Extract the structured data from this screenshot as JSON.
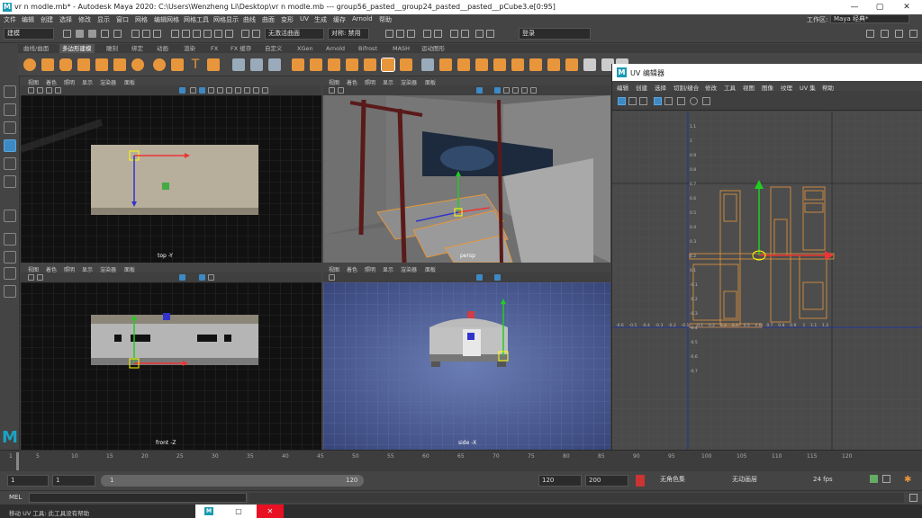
{
  "window": {
    "title": "vr n modle.mb* - Autodesk Maya 2020: C:\\Users\\Wenzheng Li\\Desktop\\vr n modle.mb   ---   group56_pasted__group24_pasted__pasted__pCube3.e[0:95]",
    "app_icon_letter": "M",
    "minimize": "—",
    "maximize": "▢",
    "close": "✕"
  },
  "menubar": {
    "items": [
      "文件",
      "编辑",
      "创建",
      "选择",
      "修改",
      "显示",
      "窗口",
      "网格",
      "编辑网格",
      "网格工具",
      "网格显示",
      "曲线",
      "曲面",
      "变形",
      "UV",
      "生成",
      "缓存",
      "Arnold",
      "帮助"
    ],
    "workspace_label": "工作区:",
    "workspace_value": "Maya 经典*"
  },
  "statusline": {
    "menuset": "建模",
    "object_field": "无激活曲面",
    "symmetry": "对称: 禁用",
    "login": "登录"
  },
  "shelf": {
    "tabs": [
      "曲线/曲面",
      "多边形建模",
      "雕刻",
      "绑定",
      "动画",
      "渲染",
      "FX",
      "FX 缓存",
      "自定义",
      "XGen",
      "Arnold",
      "Bifrost",
      "MASH",
      "运动图形"
    ],
    "active_tab_index": 1
  },
  "viewports": {
    "menu": [
      "视图",
      "着色",
      "照明",
      "显示",
      "渲染器",
      "面板"
    ],
    "top": {
      "camera": "top -Y"
    },
    "persp": {
      "camera": "persp"
    },
    "front": {
      "camera": "front -Z"
    },
    "side": {
      "camera": "side -X"
    }
  },
  "uv_editor": {
    "title": "UV 编辑器",
    "menu": [
      "编辑",
      "创建",
      "选择",
      "切割/缝合",
      "修改",
      "工具",
      "视图",
      "图像",
      "纹理",
      "UV 集",
      "帮助"
    ],
    "axis_labels_x": [
      "-0.6",
      "-0.5",
      "-0.4",
      "-0.3",
      "-0.2",
      "-0.1",
      "0.1",
      "0.2",
      "0.3",
      "0.4",
      "0.5",
      "0.6",
      "0.7",
      "0.8",
      "0.9",
      "1",
      "1.1",
      "1.2"
    ],
    "axis_labels_y": [
      "1.1",
      "1",
      "0.9",
      "0.8",
      "0.7",
      "0.6",
      "0.5",
      "0.4",
      "0.3",
      "0.2",
      "0.1",
      "-0.1",
      "-0.2",
      "-0.3",
      "-0.4",
      "-0.5",
      "-0.6",
      "-0.7"
    ]
  },
  "timeline": {
    "ticks": [
      "1",
      "5",
      "10",
      "15",
      "20",
      "25",
      "30",
      "35",
      "40",
      "45",
      "50",
      "55",
      "60",
      "65",
      "70",
      "75",
      "80",
      "85",
      "90",
      "95",
      "100",
      "105",
      "110",
      "115",
      "120"
    ],
    "current_frame": "1"
  },
  "range": {
    "start": "1",
    "playback_start": "1",
    "range_start_label": "1",
    "range_end_label": "120",
    "playback_end": "120",
    "end": "200",
    "character_set": "无角色集",
    "anim_layer": "无动画层",
    "fps": "24 fps"
  },
  "commandline": {
    "label": "MEL"
  },
  "helpline": {
    "text": "移动 UV 工具: 此工具没有帮助"
  }
}
